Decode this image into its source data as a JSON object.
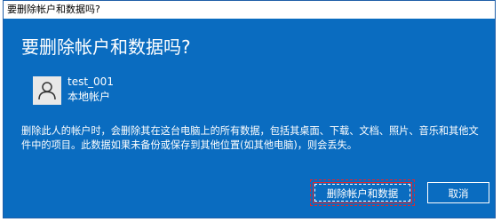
{
  "window": {
    "title": "要删除帐户和数据吗?"
  },
  "dialog": {
    "heading": "要删除帐户和数据吗?",
    "user": {
      "name": "test_001",
      "type": "本地帐户",
      "avatar_icon": "user-silhouette-icon"
    },
    "description": "删除此人的帐户时，会删除其在这台电脑上的所有数据，包括其桌面、下载、文档、照片、音乐和其他文件中的项目。此数据如果未备份或保存到其他位置(如其他电脑)，则会丢失。",
    "buttons": {
      "delete_label": "删除帐户和数据",
      "cancel_label": "取消"
    }
  },
  "colors": {
    "dialog_bg": "#0a6cc0",
    "focus_border": "#e0262f"
  }
}
